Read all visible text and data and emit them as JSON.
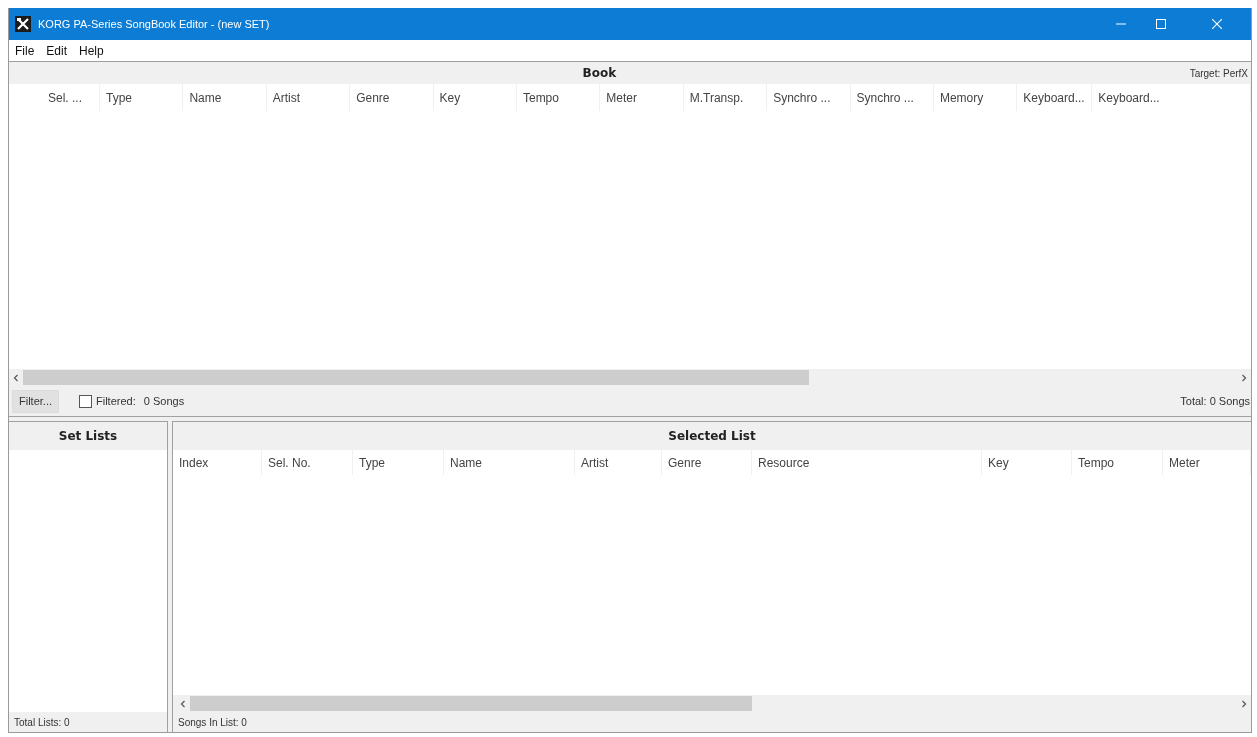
{
  "window": {
    "title": "KORG PA-Series SongBook Editor - (new SET)"
  },
  "menu": [
    "File",
    "Edit",
    "Help"
  ],
  "book": {
    "title": "Book",
    "target": "Target: PerfX",
    "columns": [
      "Sel. ...",
      "Type",
      "Name",
      "Artist",
      "Genre",
      "Key",
      "Tempo",
      "Meter",
      "M.Transp.",
      "Synchro ...",
      "Synchro ...",
      "Memory",
      "Keyboard...",
      "Keyboard..."
    ],
    "filter": {
      "button": "Filter...",
      "checkbox_label": "Filtered:",
      "checked": false,
      "count": "0 Songs"
    },
    "total": "Total: 0 Songs"
  },
  "set_lists": {
    "title": "Set Lists",
    "total": "Total Lists: 0"
  },
  "selected_list": {
    "title": "Selected List",
    "columns": [
      "Index",
      "Sel. No.",
      "Type",
      "Name",
      "Artist",
      "Genre",
      "Resource",
      "Key",
      "Tempo",
      "Meter"
    ],
    "count": "Songs In List: 0"
  }
}
